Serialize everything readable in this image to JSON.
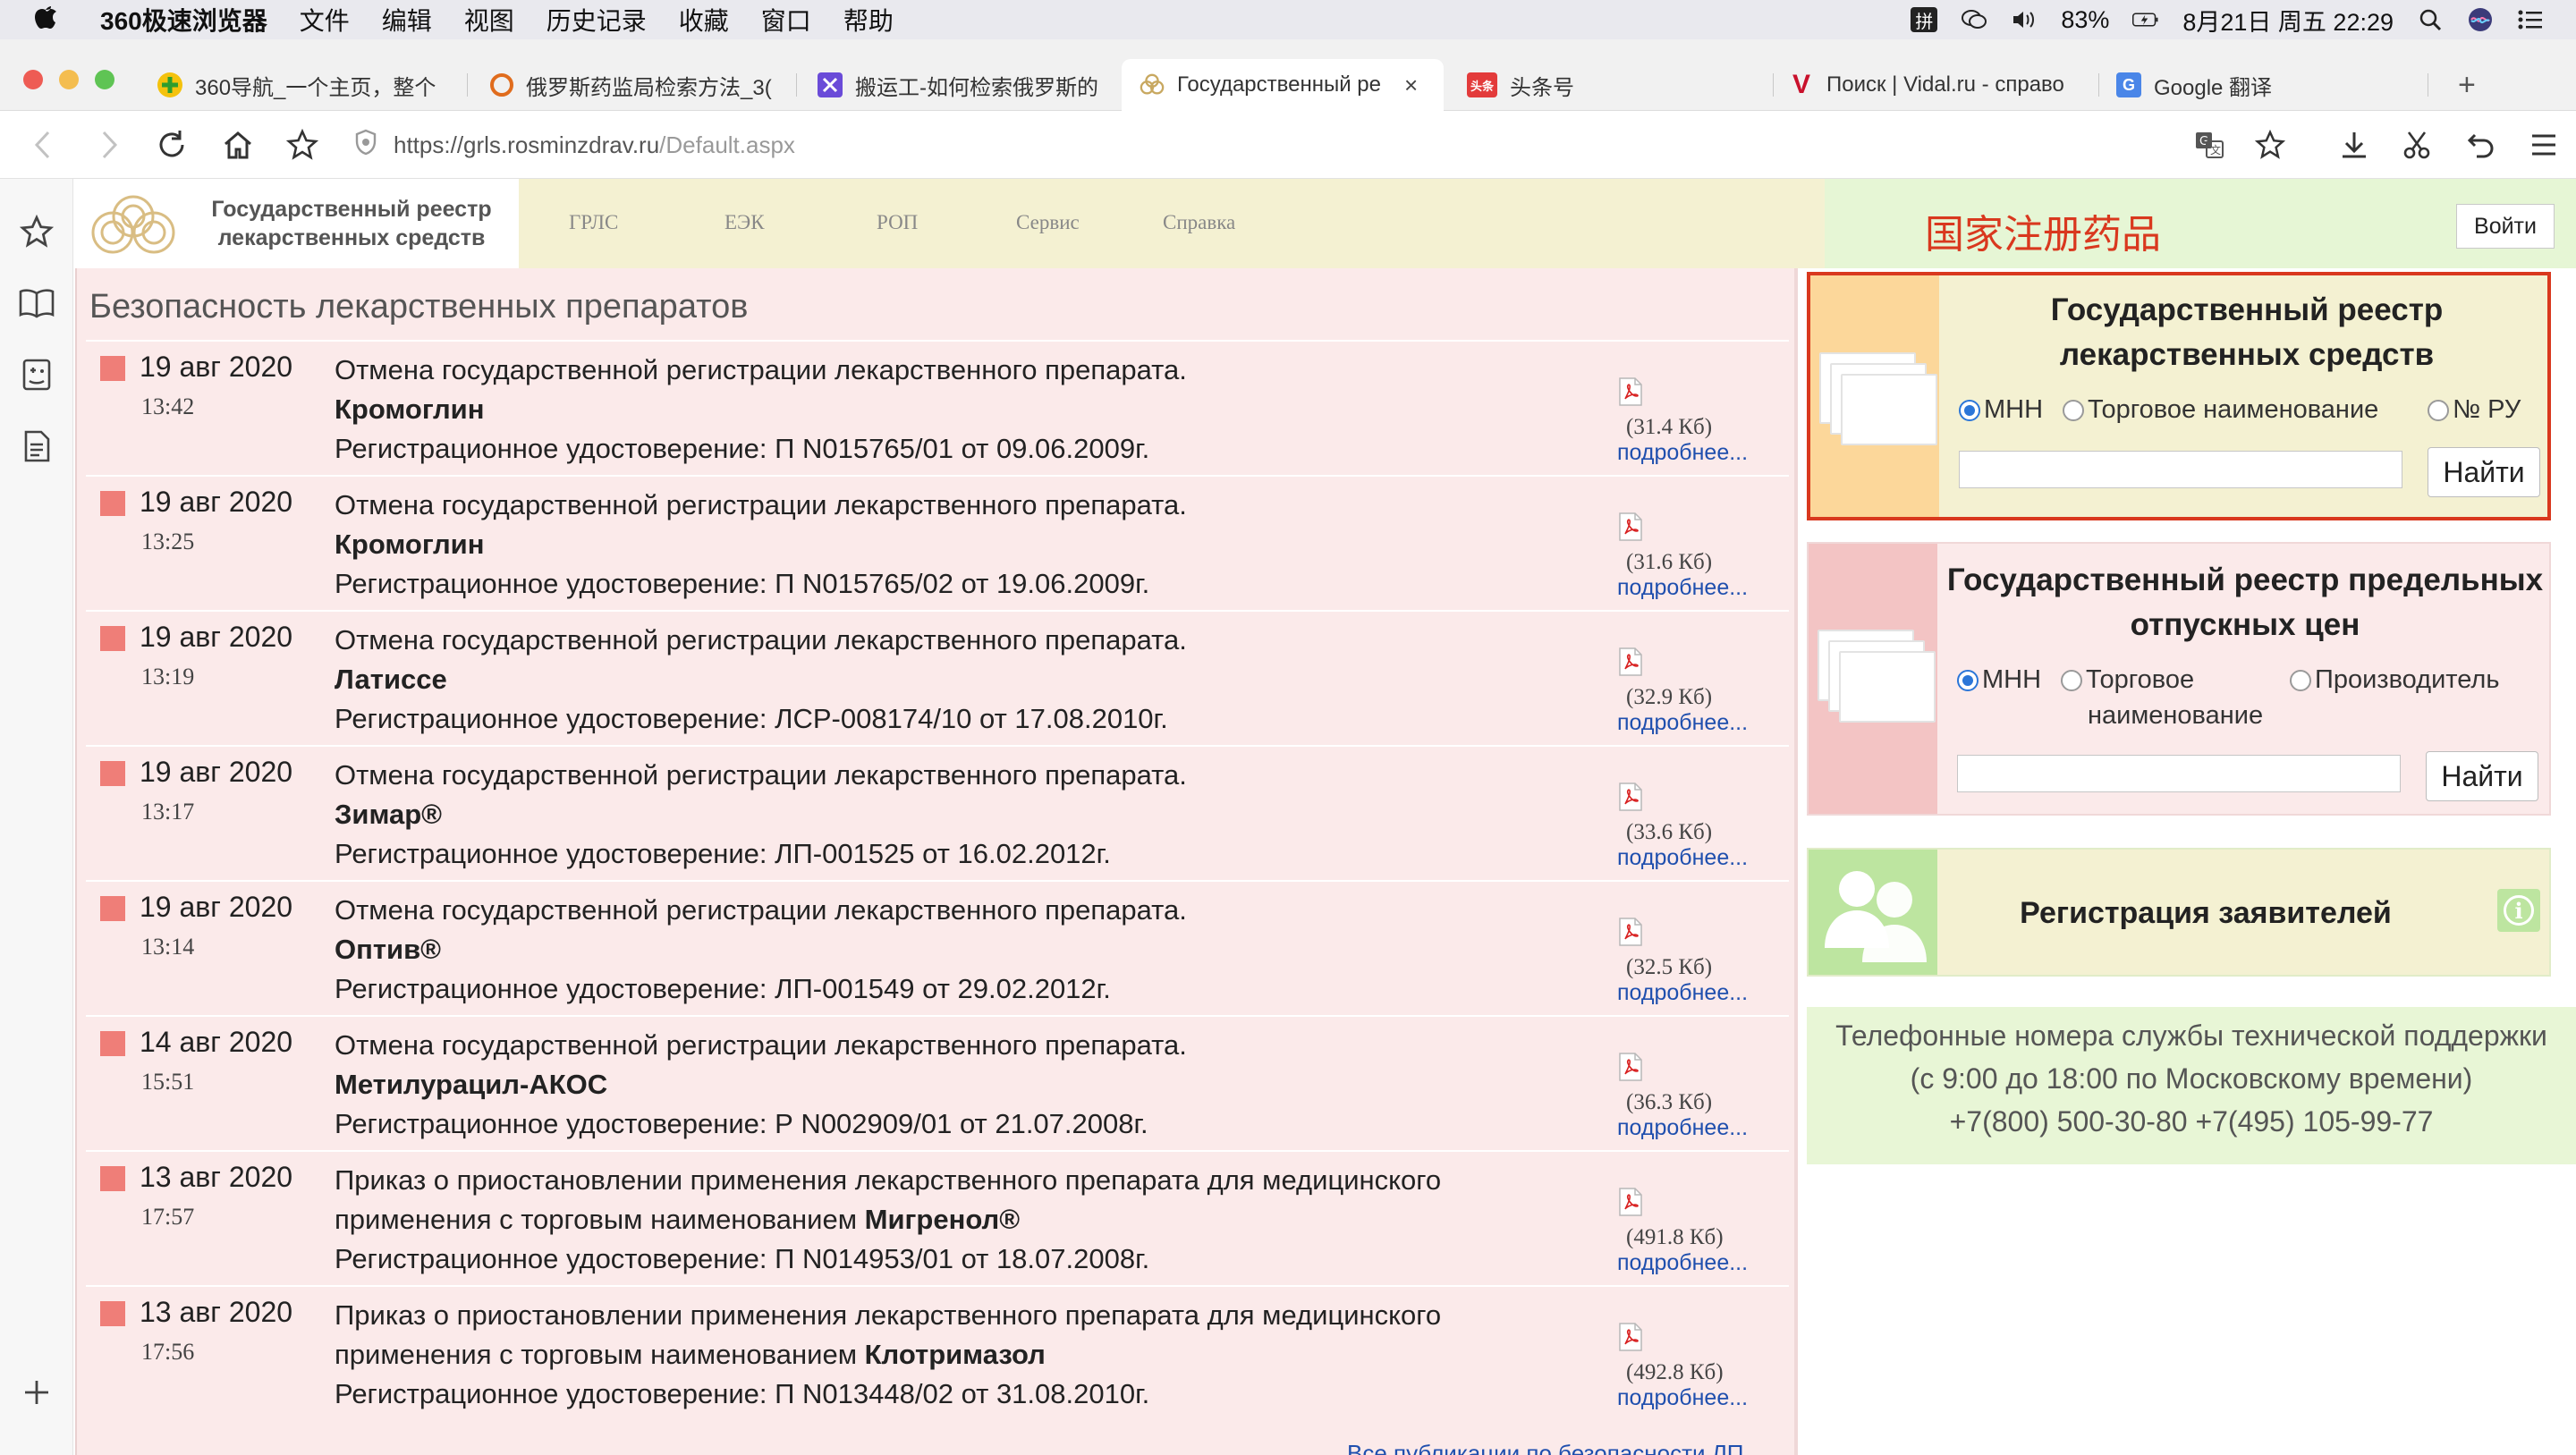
{
  "menubar": {
    "app_name": "360极速浏览器",
    "items": [
      "文件",
      "编辑",
      "视图",
      "历史记录",
      "收藏",
      "窗口",
      "帮助"
    ],
    "input_indicator": "拼",
    "battery": "83%",
    "datetime": "8月21日 周五 22:29"
  },
  "tabs": [
    {
      "label": "360导航_一个主页，整个",
      "favicon": "360-nav-icon",
      "color": "#3aa63a"
    },
    {
      "label": "俄罗斯药监局检索方法_3(",
      "favicon": "search-o-icon",
      "color": "#e06c1d"
    },
    {
      "label": "搬运工-如何检索俄罗斯的",
      "favicon": "porter-icon",
      "color": "#6a4bd8"
    },
    {
      "label": "Государственный ре",
      "favicon": "grls-icon",
      "color": "#c8a860",
      "active": true,
      "close": "×"
    },
    {
      "label": "头条号",
      "favicon": "toutiao-icon",
      "color": "#e33b3b",
      "favicon_text": "头条"
    },
    {
      "label": "Поиск | Vidal.ru - справо",
      "favicon": "vidal-icon",
      "color": "#c9112c",
      "favicon_text": "V"
    },
    {
      "label": "Google 翻译",
      "favicon": "google-translate-icon",
      "color": "#4a86e8",
      "favicon_text": "G"
    }
  ],
  "newtab_label": "+",
  "toolbar": {
    "url_host": "https://grls.rosminzdrav.ru",
    "url_path": "/Default.aspx"
  },
  "site": {
    "logo_title": "Государственный реестр лекарственных средств",
    "nav": [
      "ГРЛС",
      "ЕЭК",
      "РОП",
      "Сервис",
      "Справка"
    ],
    "cn_label": "国家注册药品",
    "login": "Войти"
  },
  "publications": {
    "title": "Безопасность лекарственных препаратов",
    "more_label": "подробнее...",
    "all_link": "Все публикации по безопасности ЛП...",
    "items": [
      {
        "date": "19 авг 2020",
        "time": "13:42",
        "line1": "Отмена государственной регистрации лекарственного препарата.",
        "drug": "Кромоглин",
        "line3": "Регистрационное удостоверение: П N015765/01 от 09.06.2009г.",
        "size": "(31.4 Кб)"
      },
      {
        "date": "19 авг 2020",
        "time": "13:25",
        "line1": "Отмена государственной регистрации лекарственного препарата.",
        "drug": "Кромоглин",
        "line3": "Регистрационное удостоверение: П N015765/02 от 19.06.2009г.",
        "size": "(31.6 Кб)"
      },
      {
        "date": "19 авг 2020",
        "time": "13:19",
        "line1": "Отмена государственной регистрации лекарственного препарата.",
        "drug": "Латиссе",
        "line3": "Регистрационное удостоверение: ЛСР-008174/10 от 17.08.2010г.",
        "size": "(32.9 Кб)"
      },
      {
        "date": "19 авг 2020",
        "time": "13:17",
        "line1": "Отмена государственной регистрации лекарственного препарата.",
        "drug": "Зимар®",
        "line3": "Регистрационное удостоверение: ЛП-001525 от 16.02.2012г.",
        "size": "(33.6 Кб)"
      },
      {
        "date": "19 авг 2020",
        "time": "13:14",
        "line1": "Отмена государственной регистрации лекарственного препарата.",
        "drug": "Оптив®",
        "line3": "Регистрационное удостоверение: ЛП-001549 от 29.02.2012г.",
        "size": "(32.5 Кб)"
      },
      {
        "date": "14 авг 2020",
        "time": "15:51",
        "line1": "Отмена государственной регистрации лекарственного препарата.",
        "drug": "Метилурацил-АКОС",
        "line3": "Регистрационное удостоверение: Р N002909/01 от 21.07.2008г.",
        "size": "(36.3 Кб)"
      },
      {
        "date": "13 авг 2020",
        "time": "17:57",
        "line1": "Приказ о приостановлении применения лекарственного препарата для медицинского",
        "line2_prefix": "применения с торговым наименованием ",
        "drug": "Мигренол®",
        "line3": "Регистрационное удостоверение: П N014953/01 от 18.07.2008г.",
        "size": "(491.8 Кб)"
      },
      {
        "date": "13 авг 2020",
        "time": "17:56",
        "line1": "Приказ о приостановлении применения лекарственного препарата для медицинского",
        "line2_prefix": "применения с торговым наименованием ",
        "drug": "Клотримазол",
        "line3": "Регистрационное удостоверение: П N013448/02 от 31.08.2010г.",
        "size": "(492.8 Кб)"
      }
    ]
  },
  "registry": {
    "title": "Государственный реестр лекарственных средств",
    "radio_mnn": "МНН",
    "radio_trade": "Торговое наименование",
    "radio_ru": "№ РУ",
    "search_value": "",
    "button": "Найти",
    "accent": "#fcd79a",
    "highlight_border": "#d9381e"
  },
  "prices": {
    "title": "Государственный реестр предельных отпускных цен",
    "radio_mnn": "МНН",
    "radio_trade_1": "Торговое",
    "radio_trade_2": "наименование",
    "radio_maker": "Производитель",
    "search_value": "",
    "button": "Найти",
    "accent": "#f3c4c4"
  },
  "applicants": {
    "title": "Регистрация заявителей",
    "info_icon": "i",
    "accent": "#bde5a0"
  },
  "support": {
    "line1": "Телефонные номера службы технической поддержки",
    "line2": "(с 9:00 до 18:00 по Московскому времени)",
    "line3": "+7(800) 500-30-80 +7(495) 105-99-77"
  }
}
